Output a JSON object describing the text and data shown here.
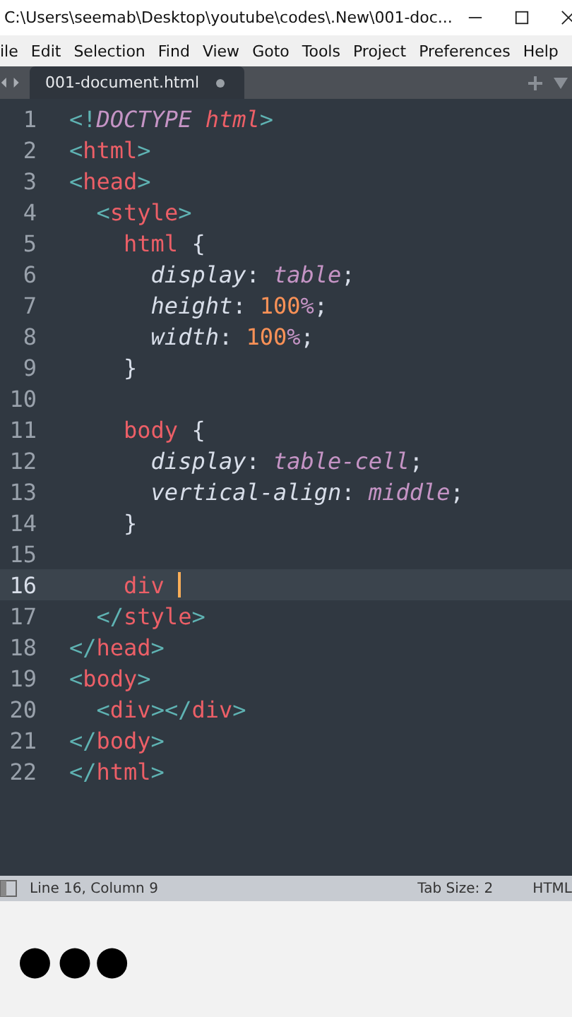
{
  "window": {
    "title": "C:\\Users\\seemab\\Desktop\\youtube\\codes\\.New\\001-doc..."
  },
  "menu": [
    "ile",
    "Edit",
    "Selection",
    "Find",
    "View",
    "Goto",
    "Tools",
    "Project",
    "Preferences",
    "Help"
  ],
  "tabs": [
    {
      "label": "001-document.html",
      "selected": true,
      "modified": true
    }
  ],
  "editor": {
    "lines": [
      {
        "number": "1",
        "current": false,
        "tokens": [
          {
            "kind": "punct",
            "text": "<!"
          },
          {
            "kind": "doctype",
            "text": "DOCTYPE "
          },
          {
            "kind": "tagi",
            "text": "html"
          },
          {
            "kind": "punct",
            "text": ">"
          }
        ]
      },
      {
        "number": "2",
        "current": false,
        "tokens": [
          {
            "kind": "punct",
            "text": "<"
          },
          {
            "kind": "tag",
            "text": "html"
          },
          {
            "kind": "punct",
            "text": ">"
          }
        ]
      },
      {
        "number": "3",
        "current": false,
        "tokens": [
          {
            "kind": "punct",
            "text": "<"
          },
          {
            "kind": "tag",
            "text": "head"
          },
          {
            "kind": "punct",
            "text": ">"
          }
        ],
        "children": [
          {
            "number": "4",
            "current": false,
            "tokens": [
              {
                "kind": "punct",
                "text": "<"
              },
              {
                "kind": "tag",
                "text": "style"
              },
              {
                "kind": "punct",
                "text": ">"
              }
            ],
            "children": [
              {
                "number": "5",
                "current": false,
                "tokens": [
                  {
                    "kind": "tag",
                    "text": "html"
                  },
                  {
                    "kind": "plain",
                    "text": " {"
                  }
                ],
                "children": [
                  {
                    "number": "6",
                    "current": false,
                    "tokens": [
                      {
                        "kind": "prop",
                        "text": "display"
                      },
                      {
                        "kind": "plain",
                        "text": ": "
                      },
                      {
                        "kind": "value",
                        "text": "table"
                      },
                      {
                        "kind": "plain",
                        "text": ";"
                      }
                    ]
                  },
                  {
                    "number": "7",
                    "current": false,
                    "tokens": [
                      {
                        "kind": "prop",
                        "text": "height"
                      },
                      {
                        "kind": "plain",
                        "text": ": "
                      },
                      {
                        "kind": "num",
                        "text": "100"
                      },
                      {
                        "kind": "value",
                        "text": "%"
                      },
                      {
                        "kind": "plain",
                        "text": ";"
                      }
                    ]
                  },
                  {
                    "number": "8",
                    "current": false,
                    "tokens": [
                      {
                        "kind": "prop",
                        "text": "width"
                      },
                      {
                        "kind": "plain",
                        "text": ": "
                      },
                      {
                        "kind": "num",
                        "text": "100"
                      },
                      {
                        "kind": "value",
                        "text": "%"
                      },
                      {
                        "kind": "plain",
                        "text": ";"
                      }
                    ]
                  }
                ]
              },
              {
                "number": "9",
                "current": false,
                "tokens": [
                  {
                    "kind": "plain",
                    "text": "}"
                  }
                ]
              },
              {
                "number": "10",
                "current": false
              },
              {
                "number": "11",
                "current": false,
                "tokens": [
                  {
                    "kind": "tag",
                    "text": "body"
                  },
                  {
                    "kind": "plain",
                    "text": " {"
                  }
                ],
                "children": [
                  {
                    "number": "12",
                    "current": false,
                    "tokens": [
                      {
                        "kind": "prop",
                        "text": "display"
                      },
                      {
                        "kind": "plain",
                        "text": ": "
                      },
                      {
                        "kind": "value",
                        "text": "table-cell"
                      },
                      {
                        "kind": "plain",
                        "text": ";"
                      }
                    ]
                  },
                  {
                    "number": "13",
                    "current": false,
                    "tokens": [
                      {
                        "kind": "prop",
                        "text": "vertical-align"
                      },
                      {
                        "kind": "plain",
                        "text": ": "
                      },
                      {
                        "kind": "value",
                        "text": "middle"
                      },
                      {
                        "kind": "plain",
                        "text": ";"
                      }
                    ]
                  }
                ]
              },
              {
                "number": "14",
                "current": false,
                "tokens": [
                  {
                    "kind": "plain",
                    "text": "}"
                  }
                ]
              },
              {
                "number": "15",
                "current": false
              },
              {
                "number": "16",
                "current": true,
                "tokens": [
                  {
                    "kind": "tag",
                    "text": "div"
                  }
                ]
              }
            ]
          },
          {
            "number": "17",
            "current": false,
            "tokens": [
              {
                "kind": "punct",
                "text": "</"
              },
              {
                "kind": "tag",
                "text": "style"
              },
              {
                "kind": "punct",
                "text": ">"
              }
            ]
          }
        ]
      },
      {
        "number": "18",
        "current": false,
        "tokens": [
          {
            "kind": "punct",
            "text": "</"
          },
          {
            "kind": "tag",
            "text": "head"
          },
          {
            "kind": "punct",
            "text": ">"
          }
        ]
      },
      {
        "number": "19",
        "current": false,
        "tokens": [
          {
            "kind": "punct",
            "text": "<"
          },
          {
            "kind": "tag",
            "text": "body"
          },
          {
            "kind": "punct",
            "text": ">"
          }
        ],
        "children": [
          {
            "number": "20",
            "current": false,
            "tokens": [
              {
                "kind": "punct",
                "text": "<"
              },
              {
                "kind": "tag",
                "text": "div"
              },
              {
                "kind": "punct",
                "text": "></"
              },
              {
                "kind": "tag",
                "text": "div"
              },
              {
                "kind": "punct",
                "text": ">"
              }
            ]
          }
        ]
      },
      {
        "number": "21",
        "current": false,
        "tokens": [
          {
            "kind": "punct",
            "text": "</"
          },
          {
            "kind": "tag",
            "text": "body"
          },
          {
            "kind": "punct",
            "text": ">"
          }
        ]
      },
      {
        "number": "22",
        "current": false,
        "tokens": [
          {
            "kind": "punct",
            "text": "</"
          },
          {
            "kind": "tag",
            "text": "html"
          },
          {
            "kind": "punct",
            "text": ">"
          }
        ]
      }
    ]
  },
  "status_bar": {
    "position": "Line 16, Column 9",
    "tab_size": "Tab Size: 2",
    "syntax": "HTML"
  }
}
